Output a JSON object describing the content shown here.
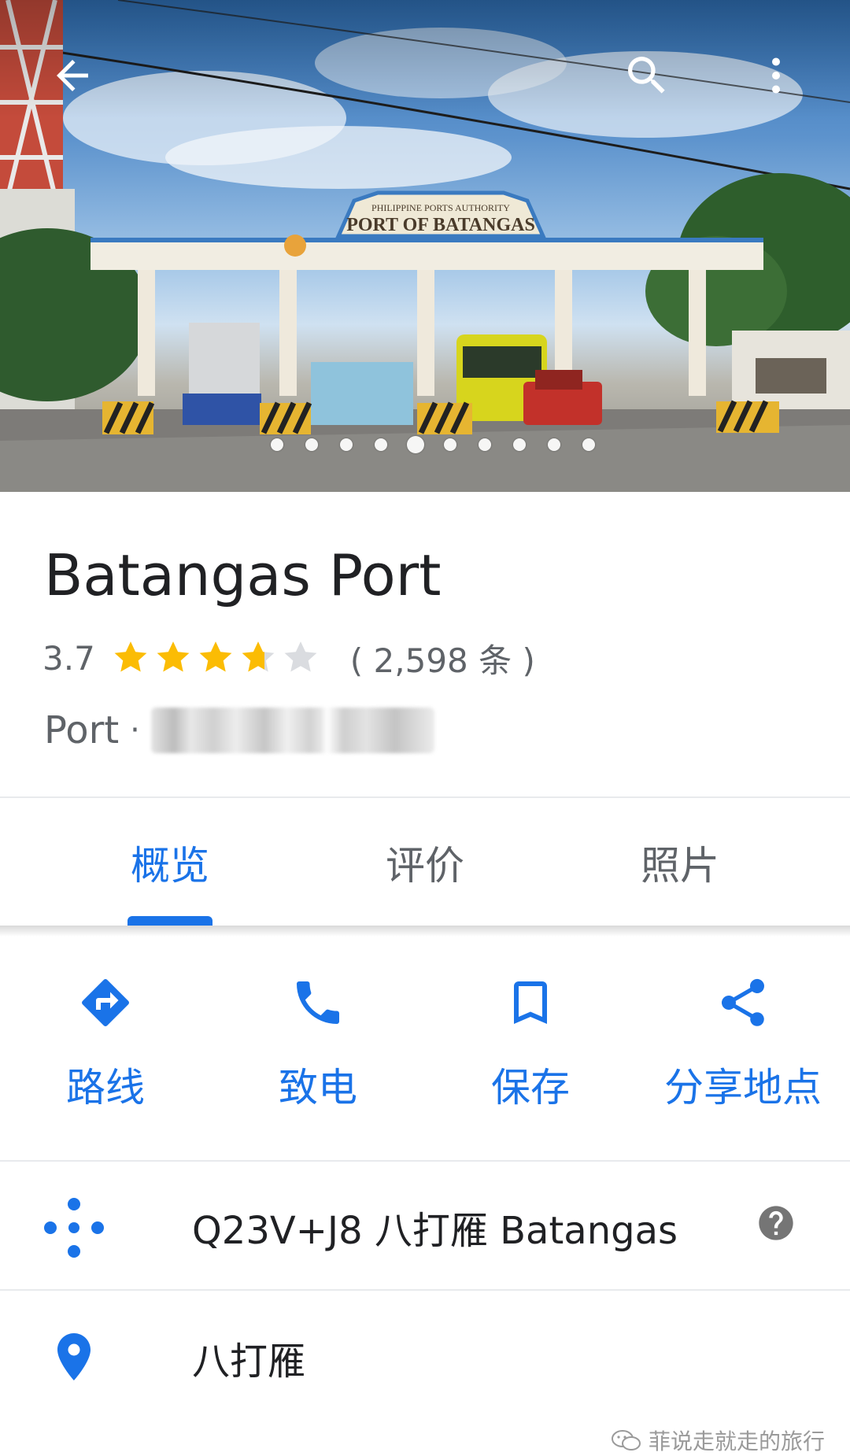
{
  "header": {
    "back_icon": "arrow-back-icon",
    "search_icon": "search-icon",
    "more_icon": "more-vert-icon",
    "photo": {
      "sign_line1": "PHILIPPINE PORTS AUTHORITY",
      "sign_line2": "PORT OF BATANGAS"
    },
    "carousel": {
      "count": 10,
      "active_index": 4
    }
  },
  "place": {
    "name": "Batangas Port",
    "rating": "3.7",
    "rating_value": 3.7,
    "star_count": 5,
    "review_count": "( 2,598 条 )",
    "category": "Port",
    "category_separator": "·"
  },
  "tabs": [
    {
      "label": "概览",
      "active": true
    },
    {
      "label": "评价",
      "active": false
    },
    {
      "label": "照片",
      "active": false
    }
  ],
  "actions": [
    {
      "label": "路线",
      "icon": "directions-icon"
    },
    {
      "label": "致电",
      "icon": "phone-icon"
    },
    {
      "label": "保存",
      "icon": "bookmark-icon"
    },
    {
      "label": "分享地点",
      "icon": "share-icon"
    }
  ],
  "rows": [
    {
      "text": "Q23V+J8 八打雁 Batangas",
      "icon": "plus-code-icon",
      "help_icon": "help-icon"
    },
    {
      "text": "八打雁",
      "icon": "location-pin-icon"
    }
  ],
  "watermark": {
    "text": "菲说走就走的旅行",
    "icon": "wechat-icon"
  },
  "colors": {
    "accent": "#1a73e8",
    "star": "#fbbc04",
    "star_empty": "#dadce0",
    "text_secondary": "#5f6368"
  }
}
